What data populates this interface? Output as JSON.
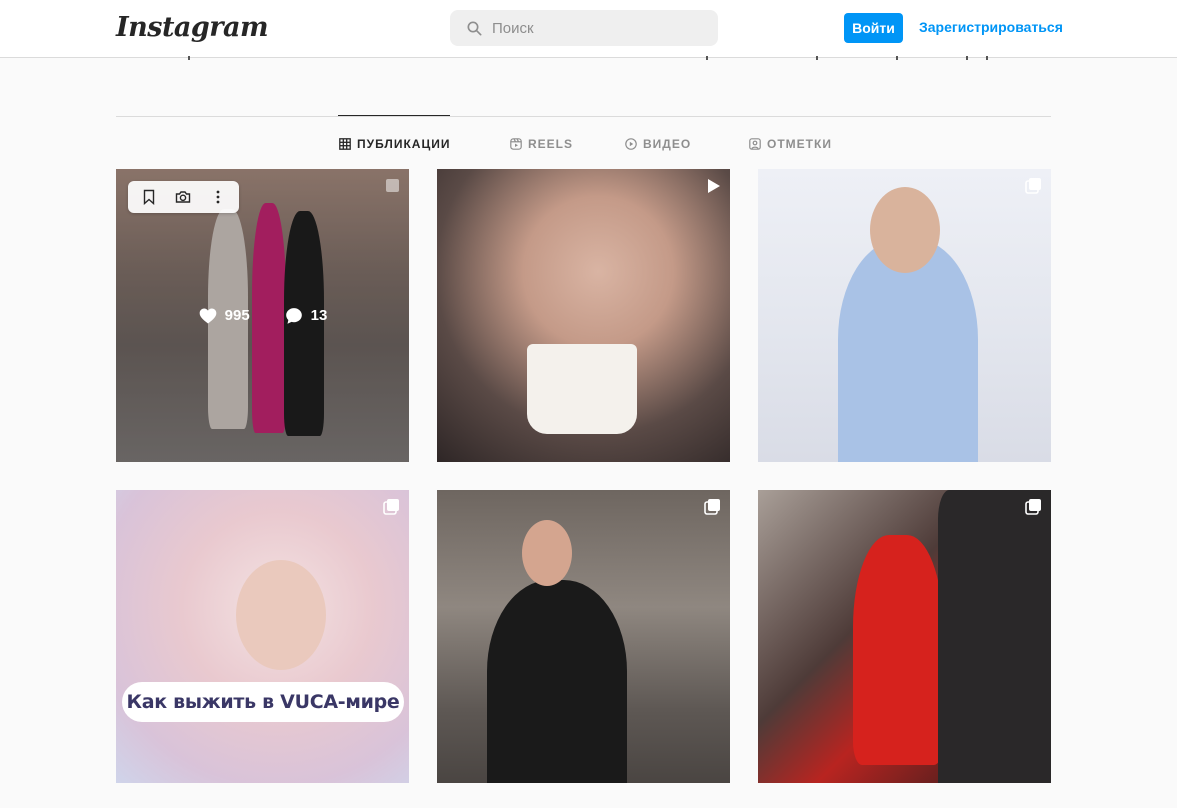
{
  "header": {
    "logo_text": "Instagram",
    "search_placeholder": "Поиск",
    "login_label": "Войти",
    "signup_label": "Зарегистрироваться"
  },
  "tabs": [
    {
      "label": "ПУБЛИКАЦИИ",
      "icon": "grid-icon",
      "active": true
    },
    {
      "label": "REELS",
      "icon": "reels-icon",
      "active": false
    },
    {
      "label": "ВИДЕО",
      "icon": "video-play-icon",
      "active": false
    },
    {
      "label": "ОТМЕТКИ",
      "icon": "tagged-icon",
      "active": false
    }
  ],
  "posts": [
    {
      "type": "carousel",
      "hovered": true,
      "likes": "995",
      "comments": "13"
    },
    {
      "type": "video"
    },
    {
      "type": "carousel"
    },
    {
      "type": "carousel",
      "caption": "Как выжить в VUCA-мире"
    },
    {
      "type": "carousel"
    },
    {
      "type": "carousel"
    }
  ],
  "colors": {
    "accent": "#0095f6",
    "text": "#262626",
    "muted": "#8e8e8e",
    "border": "#dbdbdb",
    "background": "#fafafa"
  }
}
